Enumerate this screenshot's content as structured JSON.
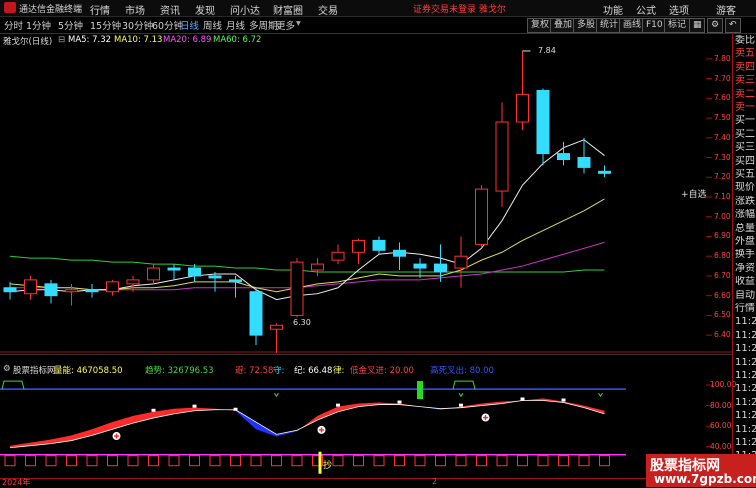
{
  "menubar": {
    "app_title": "通达信金融终端",
    "items": [
      "行情",
      "市场",
      "资讯",
      "发现",
      "问小达",
      "财富圈",
      "交易"
    ],
    "notice": "证券交易未登录  雅戈尔",
    "right_items": [
      "功能",
      "公式",
      "选项",
      "游客"
    ]
  },
  "toolbar": {
    "periods": [
      "分时",
      "1分钟",
      "5分钟",
      "15分钟",
      "30分钟",
      "60分钟",
      "日线",
      "周线",
      "月线",
      "多周期",
      "更多"
    ],
    "active_period": "日线",
    "buttons": [
      "复权",
      "叠加",
      "多股",
      "统计",
      "画线",
      "F10",
      "标记"
    ],
    "icons": [
      "grid-icon",
      "settings-icon",
      "back-icon"
    ]
  },
  "kline": {
    "stock_label": "雅戈尔(日线)",
    "ma": [
      {
        "label": "MA5: 7.32",
        "color": "#ffffff"
      },
      {
        "label": "MA10: 7.13",
        "color": "#ffff66"
      },
      {
        "label": "MA20: 6.89",
        "color": "#ff55ff"
      },
      {
        "label": "MA60: 6.72",
        "color": "#55ff55"
      }
    ],
    "high_label": "7.84",
    "low_label": "6.30",
    "y_ticks": [
      "7.80",
      "7.70",
      "7.60",
      "7.50",
      "7.40",
      "7.30",
      "7.20",
      "7.10",
      "7.00",
      "6.90",
      "6.80",
      "6.70",
      "6.60",
      "6.50",
      "6.40"
    ],
    "colors": {
      "up": "#ff3030",
      "down": "#33ddff"
    }
  },
  "chart_data": {
    "type": "candlestick",
    "series": [
      {
        "o": 6.64,
        "h": 6.67,
        "l": 6.58,
        "c": 6.62
      },
      {
        "o": 6.61,
        "h": 6.7,
        "l": 6.58,
        "c": 6.68
      },
      {
        "o": 6.66,
        "h": 6.68,
        "l": 6.56,
        "c": 6.6
      },
      {
        "o": 6.62,
        "h": 6.66,
        "l": 6.55,
        "c": 6.63
      },
      {
        "o": 6.63,
        "h": 6.66,
        "l": 6.59,
        "c": 6.62
      },
      {
        "o": 6.62,
        "h": 6.68,
        "l": 6.6,
        "c": 6.67
      },
      {
        "o": 6.66,
        "h": 6.7,
        "l": 6.62,
        "c": 6.68
      },
      {
        "o": 6.68,
        "h": 6.76,
        "l": 6.66,
        "c": 6.74
      },
      {
        "o": 6.74,
        "h": 6.76,
        "l": 6.68,
        "c": 6.73
      },
      {
        "o": 6.74,
        "h": 6.76,
        "l": 6.67,
        "c": 6.7
      },
      {
        "o": 6.7,
        "h": 6.72,
        "l": 6.62,
        "c": 6.69
      },
      {
        "o": 6.68,
        "h": 6.7,
        "l": 6.59,
        "c": 6.67
      },
      {
        "o": 6.62,
        "h": 6.64,
        "l": 6.35,
        "c": 6.4
      },
      {
        "o": 6.43,
        "h": 6.46,
        "l": 6.3,
        "c": 6.45
      },
      {
        "o": 6.5,
        "h": 6.79,
        "l": 6.49,
        "c": 6.77
      },
      {
        "o": 6.73,
        "h": 6.79,
        "l": 6.7,
        "c": 6.76
      },
      {
        "o": 6.78,
        "h": 6.86,
        "l": 6.76,
        "c": 6.82
      },
      {
        "o": 6.82,
        "h": 6.89,
        "l": 6.76,
        "c": 6.88
      },
      {
        "o": 6.88,
        "h": 6.9,
        "l": 6.81,
        "c": 6.83
      },
      {
        "o": 6.83,
        "h": 6.87,
        "l": 6.73,
        "c": 6.8
      },
      {
        "o": 6.76,
        "h": 6.79,
        "l": 6.69,
        "c": 6.74
      },
      {
        "o": 6.76,
        "h": 6.86,
        "l": 6.67,
        "c": 6.72
      },
      {
        "o": 6.74,
        "h": 6.9,
        "l": 6.64,
        "c": 6.8
      },
      {
        "o": 6.86,
        "h": 7.16,
        "l": 6.84,
        "c": 7.14
      },
      {
        "o": 7.13,
        "h": 7.58,
        "l": 7.05,
        "c": 7.48
      },
      {
        "o": 7.48,
        "h": 7.84,
        "l": 7.44,
        "c": 7.62
      },
      {
        "o": 7.64,
        "h": 7.65,
        "l": 7.26,
        "c": 7.32
      },
      {
        "o": 7.32,
        "h": 7.38,
        "l": 7.26,
        "c": 7.29
      },
      {
        "o": 7.3,
        "h": 7.4,
        "l": 7.22,
        "c": 7.25
      },
      {
        "o": 7.23,
        "h": 7.26,
        "l": 7.2,
        "c": 7.22
      }
    ],
    "ma5": [
      6.62,
      6.63,
      6.63,
      6.62,
      6.63,
      6.63,
      6.65,
      6.66,
      6.68,
      6.7,
      6.71,
      6.71,
      6.63,
      6.58,
      6.6,
      6.61,
      6.64,
      6.73,
      6.81,
      6.82,
      6.81,
      6.79,
      6.76,
      6.84,
      6.98,
      7.16,
      7.27,
      7.35,
      7.39,
      7.31
    ],
    "ma10": [
      6.66,
      6.65,
      6.64,
      6.64,
      6.63,
      6.63,
      6.64,
      6.64,
      6.65,
      6.67,
      6.67,
      6.67,
      6.64,
      6.62,
      6.64,
      6.66,
      6.67,
      6.69,
      6.71,
      6.7,
      6.7,
      6.7,
      6.73,
      6.78,
      6.82,
      6.88,
      6.93,
      6.98,
      7.03,
      7.09
    ],
    "ma20": [
      6.64,
      6.64,
      6.64,
      6.64,
      6.63,
      6.63,
      6.63,
      6.63,
      6.63,
      6.64,
      6.64,
      6.64,
      6.64,
      6.64,
      6.64,
      6.65,
      6.66,
      6.67,
      6.68,
      6.68,
      6.68,
      6.69,
      6.7,
      6.71,
      6.73,
      6.75,
      6.78,
      6.81,
      6.84,
      6.87
    ],
    "ma60": [
      6.8,
      6.79,
      6.79,
      6.78,
      6.78,
      6.77,
      6.77,
      6.76,
      6.76,
      6.75,
      6.75,
      6.74,
      6.74,
      6.73,
      6.73,
      6.72,
      6.72,
      6.72,
      6.72,
      6.72,
      6.72,
      6.72,
      6.72,
      6.72,
      6.72,
      6.72,
      6.72,
      6.72,
      6.73,
      6.73
    ],
    "ylim": [
      6.35,
      7.85
    ]
  },
  "indicator": {
    "title": "股票指标网",
    "stats": [
      {
        "label": "量能: 467058.50",
        "color": "#ffff55"
      },
      {
        "label": "趋势: 326796.53",
        "color": "#44dd44"
      },
      {
        "label": "避: 72.58",
        "color": "#ff4040"
      },
      {
        "label": "守: ",
        "color": "#33ddff"
      },
      {
        "label": "纪: 66.48",
        "color": "#ffffff"
      },
      {
        "label": "律: ",
        "color": "#ffff55"
      },
      {
        "label": "低金叉进: 20.00",
        "color": "#ff4040"
      },
      {
        "label": "高死叉出: 80.00",
        "color": "#3355ff"
      }
    ],
    "y_ticks": [
      "100.00",
      "80.00",
      "60.00",
      "40.00"
    ],
    "signal_label": "抄",
    "buy_label": "主力建仓"
  },
  "indicator_data": {
    "line_a": [
      41,
      44,
      47,
      51,
      57,
      64,
      70,
      74,
      77,
      78,
      77,
      75,
      57,
      50,
      55,
      70,
      79,
      82,
      83,
      82,
      79,
      76,
      79,
      82,
      84,
      85,
      87,
      84,
      80,
      75
    ],
    "line_b": [
      39,
      41,
      43,
      46,
      51,
      57,
      63,
      68,
      72,
      75,
      76,
      76,
      64,
      52,
      56,
      66,
      74,
      79,
      81,
      81,
      79,
      77,
      78,
      80,
      82,
      85,
      85,
      83,
      78,
      72
    ],
    "plus_marks": [
      5,
      15,
      23
    ],
    "dot_marks": [
      7,
      9,
      11,
      16,
      19,
      22,
      25,
      27
    ],
    "up_arrows": [
      13,
      22
    ],
    "down_arrows": [
      29
    ],
    "green_bar_index": 20,
    "green_bumps": [
      0,
      22
    ],
    "ylim": [
      30,
      102
    ]
  },
  "right_panel": {
    "labels": [
      "委比",
      "卖五",
      "卖四",
      "卖三",
      "卖二",
      "卖一",
      "买一",
      "买二",
      "买三",
      "买四",
      "买五",
      "现价",
      "涨跌",
      "涨幅",
      "总量",
      "外盘",
      "换手",
      "净资",
      "收益",
      "自动",
      "行情",
      "11:2",
      "11:2",
      "11:2",
      "11:2",
      "11:2",
      "11:2",
      "11:2",
      "11:2",
      "11:2",
      "11:2",
      "11:2"
    ],
    "check_label": "+自选"
  },
  "footer": {
    "year": "2024年",
    "date_mark": "2"
  },
  "watermark": {
    "line1": "股票指标网",
    "line2": "www.7gpzb.com"
  }
}
